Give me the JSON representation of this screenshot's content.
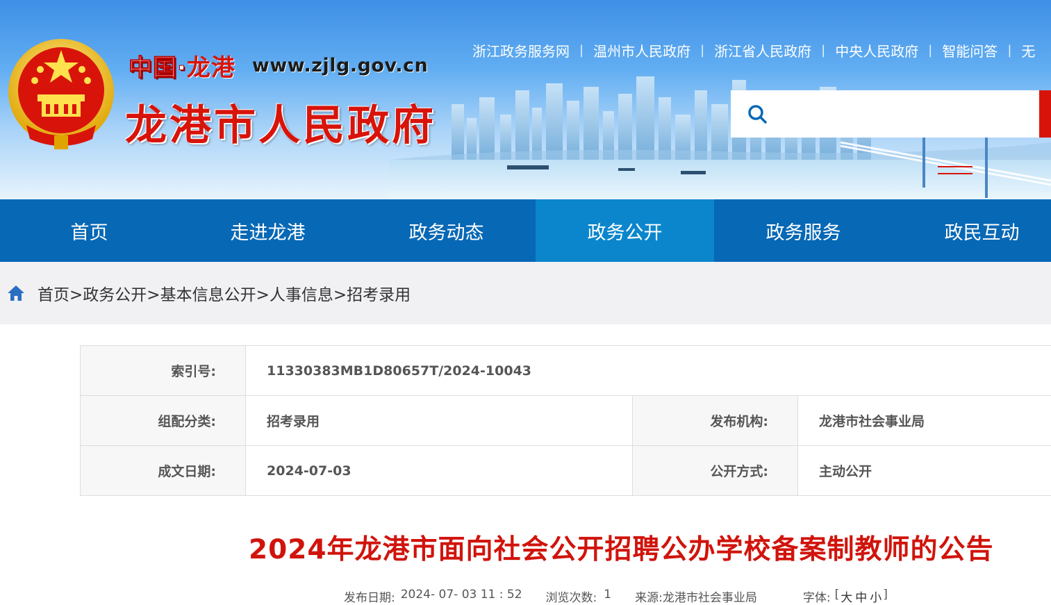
{
  "header": {
    "brand_country": "中国",
    "brand_dot": "·",
    "brand_city": "龙港",
    "site_url": "www.zjlg.gov.cn",
    "site_name": "龙港市人民政府",
    "top_links": [
      "浙江政务服务网",
      "温州市人民政府",
      "浙江省人民政府",
      "中央人民政府",
      "智能问答",
      "无"
    ],
    "search_placeholder": ""
  },
  "nav": {
    "items": [
      "首页",
      "走进龙港",
      "政务动态",
      "政务公开",
      "政务服务",
      "政民互动"
    ],
    "active_index": 3
  },
  "breadcrumb": {
    "items": [
      "首页>",
      "政务公开>",
      "基本信息公开>",
      "人事信息>",
      "招考录用"
    ]
  },
  "info": {
    "index_label": "索引号:",
    "index_value": "11330383MB1D80657T/2024-10043",
    "category_label": "组配分类:",
    "category_value": "招考录用",
    "publisher_label": "发布机构:",
    "publisher_value": "龙港市社会事业局",
    "date_label": "成文日期:",
    "date_value": "2024-07-03",
    "mode_label": "公开方式:",
    "mode_value": "主动公开"
  },
  "article": {
    "title": "2024年龙港市面向社会公开招聘公办学校备案制教师的公告",
    "publish_label": "发布日期:",
    "publish_value": "2024- 07- 03 11 : 52",
    "views_label": "浏览次数:",
    "views_value": "1",
    "source_label": "来源:",
    "source_value": "龙港市社会事业局",
    "font_label": "字体:",
    "font_open": "[",
    "font_large": "大",
    "font_medium": "中",
    "font_small": "小",
    "font_close": "]"
  },
  "colors": {
    "nav_bg": "#0768b5",
    "nav_active": "#0b86cc",
    "accent_red": "#d8140a",
    "title_red": "#d0140c"
  }
}
